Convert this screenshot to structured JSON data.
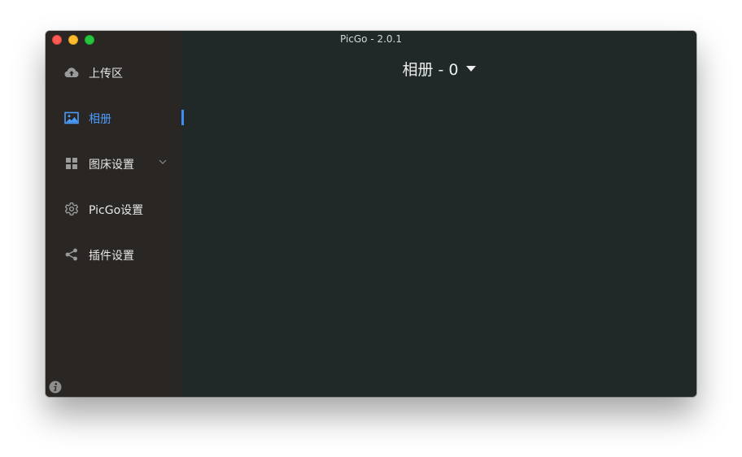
{
  "window": {
    "title": "PicGo - 2.0.1"
  },
  "sidebar": {
    "items": [
      {
        "label": "上传区",
        "icon": "cloud-upload-icon",
        "active": false
      },
      {
        "label": "相册",
        "icon": "image-icon",
        "active": true
      },
      {
        "label": "图床设置",
        "icon": "grid-icon",
        "active": false,
        "expandable": true
      },
      {
        "label": "PicGo设置",
        "icon": "gear-icon",
        "active": false
      },
      {
        "label": "插件设置",
        "icon": "share-icon",
        "active": false
      }
    ],
    "footer_icon": "info-icon"
  },
  "main": {
    "title": "相册 - 0",
    "title_icon": "caret-down-icon"
  },
  "colors": {
    "sidebar_bg": "#2a2624",
    "main_bg": "#202828",
    "accent": "#4a9cfa",
    "text": "#e6e6e6",
    "icon": "#9a9a9a"
  }
}
